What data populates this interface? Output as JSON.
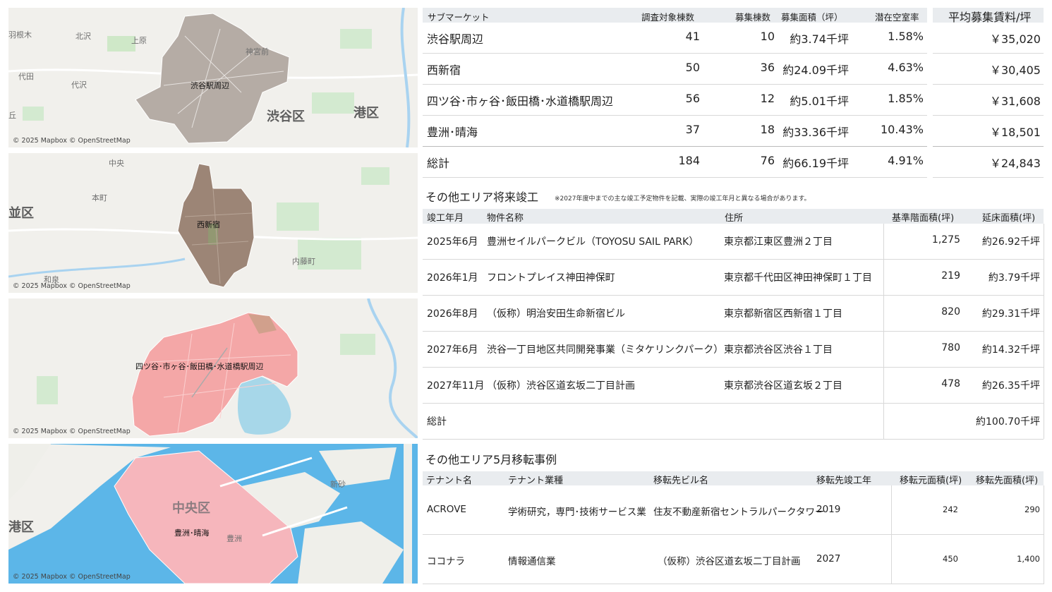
{
  "maps": [
    {
      "credit": "© 2025 Mapbox © OpenStreetMap",
      "area_label": "渋谷駅周辺",
      "labels": [
        "羽根木",
        "北沢",
        "上原",
        "神宮前",
        "代田",
        "代沢",
        "丘"
      ],
      "big_labels": [
        "渋谷区",
        "港区"
      ],
      "fill": "#b5aca5"
    },
    {
      "credit": "© 2025 Mapbox © OpenStreetMap",
      "area_label": "西新宿",
      "labels": [
        "中央",
        "本町",
        "内藤町",
        "和泉"
      ],
      "big_labels": [
        "並区"
      ],
      "fill": "#9c8576"
    },
    {
      "credit": "© 2025 Mapbox © OpenStreetMap",
      "area_label": "四ツ谷･市ヶ谷･飯田橋･水道橋駅周辺",
      "labels": [],
      "big_labels": [],
      "fill": "#f4a7a7"
    },
    {
      "credit": "© 2025 Mapbox © OpenStreetMap",
      "area_label": "豊洲･晴海",
      "labels": [
        "新砂",
        "豊洲"
      ],
      "big_labels": [
        "中央区",
        "港区"
      ],
      "fill": "#f6b6bc"
    }
  ],
  "submarket": {
    "headers": {
      "name": "サブマーケット",
      "surveyed": "調査対象棟数",
      "recruiting": "募集棟数",
      "area": "募集面積（坪）",
      "vacancy": "潜在空室率",
      "rent": "平均募集賃料/坪"
    },
    "rows": [
      {
        "name": "渋谷駅周辺",
        "surveyed": "41",
        "recruiting": "10",
        "area": "約3.74千坪",
        "vacancy": "1.58%",
        "rent": "￥35,020"
      },
      {
        "name": "西新宿",
        "surveyed": "50",
        "recruiting": "36",
        "area": "約24.09千坪",
        "vacancy": "4.63%",
        "rent": "￥30,405"
      },
      {
        "name": "四ツ谷･市ヶ谷･飯田橋･水道橋駅周辺",
        "surveyed": "56",
        "recruiting": "12",
        "area": "約5.01千坪",
        "vacancy": "1.85%",
        "rent": "￥31,608"
      },
      {
        "name": "豊洲･晴海",
        "surveyed": "37",
        "recruiting": "18",
        "area": "約33.36千坪",
        "vacancy": "10.43%",
        "rent": "￥18,501"
      }
    ],
    "total": {
      "name": "総計",
      "surveyed": "184",
      "recruiting": "76",
      "area": "約66.19千坪",
      "vacancy": "4.91%",
      "rent": "￥24,843"
    }
  },
  "future": {
    "title": "その他エリア将来竣工",
    "note": "※2027年度中までの主な竣工予定物件を記載、実際の竣工年月と異なる場合があります。",
    "headers": {
      "date": "竣工年月",
      "name": "物件名称",
      "address": "住所",
      "floor": "基準階面積(坪)",
      "total": "延床面積(坪)"
    },
    "rows": [
      {
        "date": "2025年6月",
        "name": "豊洲セイルパークビル（TOYOSU SAIL PARK）",
        "address": "東京都江東区豊洲２丁目",
        "floor": "1,275",
        "total": "約26.92千坪"
      },
      {
        "date": "2026年1月",
        "name": "フロントプレイス神田神保町",
        "address": "東京都千代田区神田神保町１丁目",
        "floor": "219",
        "total": "約3.79千坪"
      },
      {
        "date": "2026年8月",
        "name": "（仮称）明治安田生命新宿ビル",
        "address": "東京都新宿区西新宿１丁目",
        "floor": "820",
        "total": "約29.31千坪"
      },
      {
        "date": "2027年6月",
        "name": "渋谷一丁目地区共同開発事業（ミタケリンクパーク）",
        "address": "東京都渋谷区渋谷１丁目",
        "floor": "780",
        "total": "約14.32千坪"
      },
      {
        "date": "2027年11月",
        "name": "（仮称）渋谷区道玄坂二丁目計画",
        "address": "東京都渋谷区道玄坂２丁目",
        "floor": "478",
        "total": "約26.35千坪"
      }
    ],
    "total": {
      "label": "総計",
      "total": "約100.70千坪"
    }
  },
  "relocation": {
    "title": "その他エリア5月移転事例",
    "headers": {
      "tenant": "テナント名",
      "industry": "テナント業種",
      "building": "移転先ビル名",
      "year": "移転先竣工年",
      "from": "移転元面積(坪)",
      "to": "移転先面積(坪)"
    },
    "rows": [
      {
        "tenant": "ACROVE",
        "industry": "学術研究，専門･技術サービス業",
        "building": "住友不動産新宿セントラルパークタワー",
        "year": "2019",
        "from": "242",
        "to": "290"
      },
      {
        "tenant": "ココナラ",
        "industry": "情報通信業",
        "building": "（仮称）渋谷区道玄坂二丁目計画",
        "year": "2027",
        "from": "450",
        "to": "1,400"
      }
    ]
  }
}
